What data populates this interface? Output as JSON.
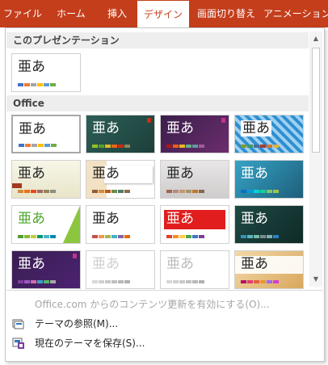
{
  "ribbon": {
    "bg": "#c43e1c",
    "tabs": [
      "ファイル",
      "ホーム",
      "挿入",
      "デザイン",
      "画面切り替え",
      "アニメーション"
    ],
    "active_tab": "デザイン"
  },
  "gallery": {
    "section_current": "このプレゼンテーション",
    "section_office": "Office",
    "tile_text": "亜あ",
    "themes": [
      "current-office-theme",
      "office-theme",
      "facet",
      "ion-boardroom",
      "organic",
      "retrospect",
      "slice",
      "wisp",
      "ion",
      "integral",
      "basis",
      "berlin",
      "circuit",
      "depth",
      "dividend",
      "frame",
      "gallery"
    ]
  },
  "commands": {
    "enable_updates": "Office.com からのコンテンツ更新を有効にする(O)...",
    "browse": "テーマの参照(M)...",
    "save": "現在のテーマを保存(S)..."
  }
}
